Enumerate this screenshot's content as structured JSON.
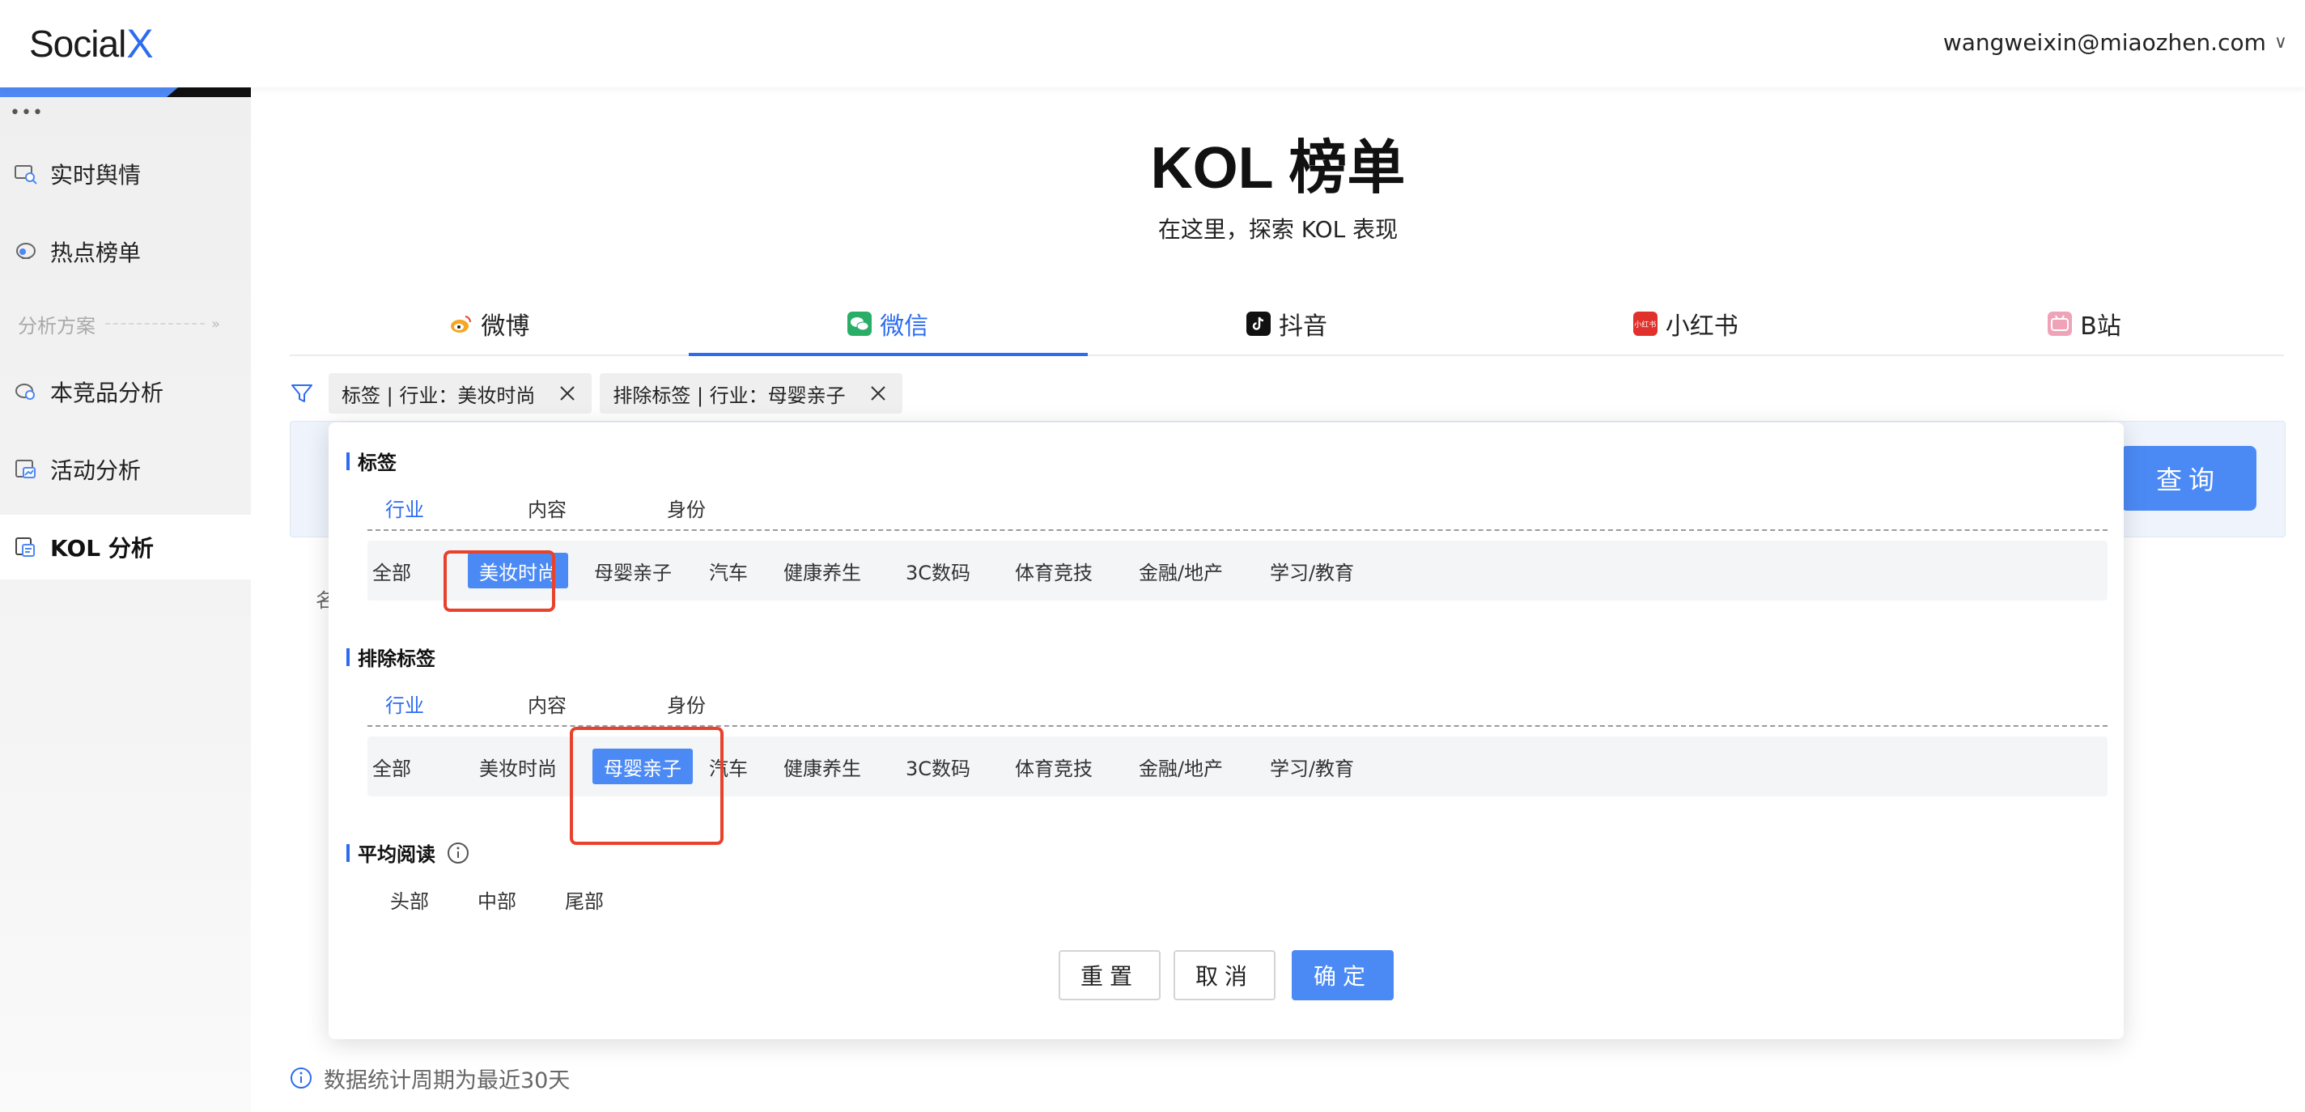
{
  "header": {
    "logo_text": "Social",
    "logo_accent": "X",
    "user_email": "wangweixin@miaozhen.com",
    "user_chevron": "∨"
  },
  "sidebar": {
    "dots": "•••",
    "items": [
      {
        "label": "实时舆情",
        "icon": "monitor-search-icon"
      },
      {
        "label": "热点榜单",
        "icon": "trophy-icon"
      },
      {
        "label": "本竞品分析",
        "icon": "compare-icon"
      },
      {
        "label": "活动分析",
        "icon": "chart-icon"
      },
      {
        "label": "KOL 分析",
        "icon": "kol-icon"
      }
    ],
    "section_label": "分析方案",
    "section_chevron": "»",
    "active_item": "KOL 分析"
  },
  "main": {
    "title": "KOL 榜单",
    "subtitle": "在这里，探索 KOL 表现",
    "platform_tabs": [
      {
        "label": "微博",
        "icon": "weibo-icon",
        "icon_color": "#f5a623"
      },
      {
        "label": "微信",
        "icon": "wechat-icon",
        "icon_color": "#2aae67"
      },
      {
        "label": "抖音",
        "icon": "douyin-icon",
        "icon_color": "#111111"
      },
      {
        "label": "小红书",
        "icon": "xiaohongshu-icon",
        "icon_color": "#e0312c",
        "icon_text": "小红书"
      },
      {
        "label": "B站",
        "icon": "bilibili-icon",
        "icon_color": "#f0a2b8"
      }
    ],
    "active_platform": "微信",
    "filter_chips": [
      {
        "label": "标签 | 行业：美妆时尚"
      },
      {
        "label": "排除标签 | 行业：母婴亲子"
      }
    ],
    "query_button": "查询",
    "behind_text": "名",
    "footnote": "数据统计周期为最近30天"
  },
  "popover": {
    "tag_section": {
      "title": "标签",
      "subtabs": [
        "行业",
        "内容",
        "身份"
      ],
      "active_subtab": "行业",
      "options": [
        "全部",
        "美妆时尚",
        "母婴亲子",
        "汽车",
        "健康养生",
        "3C数码",
        "体育竞技",
        "金融/地产",
        "学习/教育"
      ],
      "selected": "美妆时尚"
    },
    "exclude_section": {
      "title": "排除标签",
      "subtabs": [
        "行业",
        "内容",
        "身份"
      ],
      "active_subtab": "行业",
      "options": [
        "全部",
        "美妆时尚",
        "母婴亲子",
        "汽车",
        "健康养生",
        "3C数码",
        "体育竞技",
        "金融/地产",
        "学习/教育"
      ],
      "selected": "母婴亲子"
    },
    "avg_read_section": {
      "title": "平均阅读",
      "options": [
        "头部",
        "中部",
        "尾部"
      ]
    },
    "buttons": {
      "reset": "重置",
      "cancel": "取消",
      "confirm": "确定"
    }
  },
  "colors": {
    "accent": "#2d6cf0",
    "primary_button": "#4b8af5",
    "highlight_box": "#e8412c"
  }
}
